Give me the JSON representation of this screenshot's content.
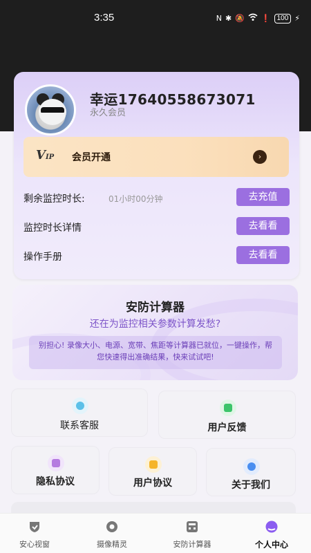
{
  "status": {
    "time": "3:35",
    "battery": "100"
  },
  "profile": {
    "username": "幸运17640558673071",
    "member_type": "永久会员"
  },
  "vip": {
    "logo": "VIP",
    "label": "会员开通",
    "arrow": "›"
  },
  "rows": [
    {
      "label": "剩余监控时长:",
      "value": "01小时00分钟",
      "button": "去充值"
    },
    {
      "label": "监控时长详情",
      "value": "",
      "button": "去看看"
    },
    {
      "label": "操作手册",
      "value": "",
      "button": "去看看"
    }
  ],
  "calculator": {
    "title": "安防计算器",
    "subtitle": "还在为监控相关参数计算发愁?",
    "description": "别担心! 录像大小、电源、宽带、焦距等计算器已就位，一键操作，帮您快速得出准确结果，快来试试吧!"
  },
  "tiles": [
    {
      "label": "联系客服",
      "icon": "headset-icon",
      "color": "#5bc0e8"
    },
    {
      "label": "用户反馈",
      "icon": "chat-icon",
      "color": "#3cc46a"
    },
    {
      "label": "隐私协议",
      "icon": "lock-icon",
      "color": "#b57be0"
    },
    {
      "label": "用户协议",
      "icon": "document-icon",
      "color": "#f5b428"
    },
    {
      "label": "关于我们",
      "icon": "info-icon",
      "color": "#4a8ef0"
    }
  ],
  "tabs": [
    {
      "label": "安心视窗",
      "icon": "shield-icon",
      "active": false
    },
    {
      "label": "摄像精灵",
      "icon": "camera-icon",
      "active": false
    },
    {
      "label": "安防计算器",
      "icon": "calculator-icon",
      "active": false
    },
    {
      "label": "个人中心",
      "icon": "user-icon",
      "active": true
    }
  ],
  "colors": {
    "accent": "#9b6fe0",
    "vip_gold": "#fbe0bd",
    "active_tab": "#8b5cf0"
  }
}
